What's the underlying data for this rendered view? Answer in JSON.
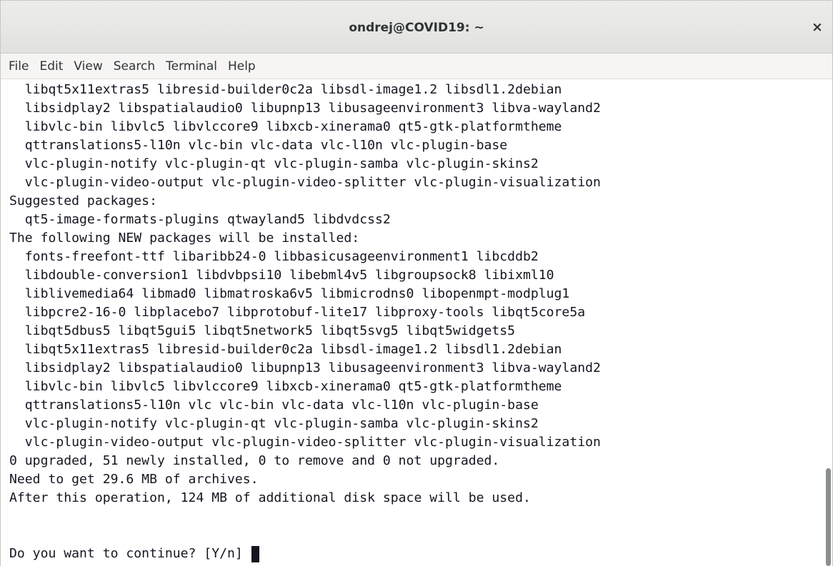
{
  "window": {
    "title": "ondrej@COVID19: ~",
    "close_label": "×"
  },
  "menubar": {
    "items": [
      "File",
      "Edit",
      "View",
      "Search",
      "Terminal",
      "Help"
    ]
  },
  "terminal": {
    "lines": [
      "  libqt5x11extras5 libresid-builder0c2a libsdl-image1.2 libsdl1.2debian",
      "  libsidplay2 libspatialaudio0 libupnp13 libusageenvironment3 libva-wayland2",
      "  libvlc-bin libvlc5 libvlccore9 libxcb-xinerama0 qt5-gtk-platformtheme",
      "  qttranslations5-l10n vlc-bin vlc-data vlc-l10n vlc-plugin-base",
      "  vlc-plugin-notify vlc-plugin-qt vlc-plugin-samba vlc-plugin-skins2",
      "  vlc-plugin-video-output vlc-plugin-video-splitter vlc-plugin-visualization",
      "Suggested packages:",
      "  qt5-image-formats-plugins qtwayland5 libdvdcss2",
      "The following NEW packages will be installed:",
      "  fonts-freefont-ttf libaribb24-0 libbasicusageenvironment1 libcddb2",
      "  libdouble-conversion1 libdvbpsi10 libebml4v5 libgroupsock8 libixml10",
      "  liblivemedia64 libmad0 libmatroska6v5 libmicrodns0 libopenmpt-modplug1",
      "  libpcre2-16-0 libplacebo7 libprotobuf-lite17 libproxy-tools libqt5core5a",
      "  libqt5dbus5 libqt5gui5 libqt5network5 libqt5svg5 libqt5widgets5",
      "  libqt5x11extras5 libresid-builder0c2a libsdl-image1.2 libsdl1.2debian",
      "  libsidplay2 libspatialaudio0 libupnp13 libusageenvironment3 libva-wayland2",
      "  libvlc-bin libvlc5 libvlccore9 libxcb-xinerama0 qt5-gtk-platformtheme",
      "  qttranslations5-l10n vlc vlc-bin vlc-data vlc-l10n vlc-plugin-base",
      "  vlc-plugin-notify vlc-plugin-qt vlc-plugin-samba vlc-plugin-skins2",
      "  vlc-plugin-video-output vlc-plugin-video-splitter vlc-plugin-visualization",
      "0 upgraded, 51 newly installed, 0 to remove and 0 not upgraded.",
      "Need to get 29.6 MB of archives.",
      "After this operation, 124 MB of additional disk space will be used."
    ],
    "prompt": "Do you want to continue? [Y/n] "
  }
}
